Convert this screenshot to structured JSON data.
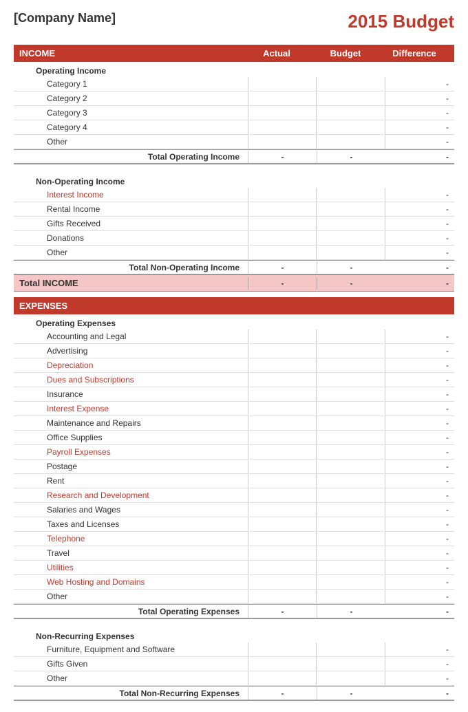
{
  "header": {
    "company_name": "[Company Name]",
    "budget_title": "2015 Budget"
  },
  "income_section": {
    "label": "INCOME",
    "col_actual": "Actual",
    "col_budget": "Budget",
    "col_difference": "Difference",
    "operating_income": {
      "label": "Operating Income",
      "items": [
        {
          "label": "Category 1",
          "red": false
        },
        {
          "label": "Category 2",
          "red": false
        },
        {
          "label": "Category 3",
          "red": false
        },
        {
          "label": "Category 4",
          "red": false
        },
        {
          "label": "Other",
          "red": false
        }
      ],
      "total_label": "Total Operating Income",
      "total_actual": "-",
      "total_budget": "-",
      "total_diff": "-"
    },
    "non_operating_income": {
      "label": "Non-Operating Income",
      "items": [
        {
          "label": "Interest Income",
          "red": true
        },
        {
          "label": "Rental Income",
          "red": false
        },
        {
          "label": "Gifts Received",
          "red": false
        },
        {
          "label": "Donations",
          "red": false
        },
        {
          "label": "Other",
          "red": false
        }
      ],
      "total_label": "Total Non-Operating Income",
      "total_actual": "-",
      "total_budget": "-",
      "total_diff": "-"
    },
    "grand_total_label": "Total INCOME",
    "grand_total_actual": "-",
    "grand_total_budget": "-",
    "grand_total_diff": "-"
  },
  "expenses_section": {
    "label": "EXPENSES",
    "operating_expenses": {
      "label": "Operating Expenses",
      "items": [
        {
          "label": "Accounting and Legal",
          "red": false
        },
        {
          "label": "Advertising",
          "red": false
        },
        {
          "label": "Depreciation",
          "red": true
        },
        {
          "label": "Dues and Subscriptions",
          "red": true
        },
        {
          "label": "Insurance",
          "red": false
        },
        {
          "label": "Interest Expense",
          "red": true
        },
        {
          "label": "Maintenance and Repairs",
          "red": false
        },
        {
          "label": "Office Supplies",
          "red": false
        },
        {
          "label": "Payroll Expenses",
          "red": true
        },
        {
          "label": "Postage",
          "red": false
        },
        {
          "label": "Rent",
          "red": false
        },
        {
          "label": "Research and Development",
          "red": true
        },
        {
          "label": "Salaries and Wages",
          "red": false
        },
        {
          "label": "Taxes and Licenses",
          "red": false
        },
        {
          "label": "Telephone",
          "red": true
        },
        {
          "label": "Travel",
          "red": false
        },
        {
          "label": "Utilities",
          "red": true
        },
        {
          "label": "Web Hosting and Domains",
          "red": true
        },
        {
          "label": "Other",
          "red": false
        }
      ],
      "total_label": "Total Operating Expenses",
      "total_actual": "-",
      "total_budget": "-",
      "total_diff": "-"
    },
    "non_recurring_expenses": {
      "label": "Non-Recurring Expenses",
      "items": [
        {
          "label": "Furniture, Equipment and Software",
          "red": false
        },
        {
          "label": "Gifts Given",
          "red": false
        },
        {
          "label": "Other",
          "red": false
        }
      ],
      "total_label": "Total Non-Recurring Expenses",
      "total_actual": "-",
      "total_budget": "-",
      "total_diff": "-"
    }
  }
}
